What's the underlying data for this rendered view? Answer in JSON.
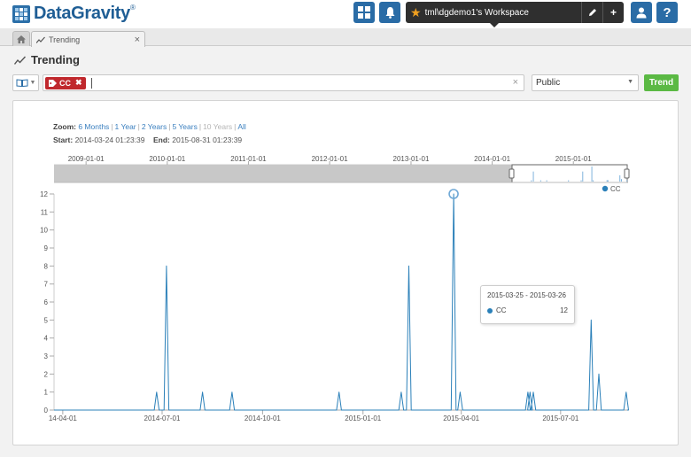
{
  "app": {
    "brand": "DataGravity",
    "brand_tm": "®",
    "workspace_label": "tml\\dgdemo1's Workspace"
  },
  "header": {
    "icons": [
      "dashboard-grid-icon",
      "bell-icon",
      "star-icon",
      "pencil-icon",
      "plus-icon",
      "user-icon",
      "help-icon"
    ],
    "help_label": "?",
    "plus_label": "+"
  },
  "tabs": [
    {
      "label": "Trending",
      "close": "×"
    }
  ],
  "page": {
    "title": "Trending"
  },
  "search": {
    "chip_label": "CC",
    "chip_close": "✖",
    "clear_label": "×",
    "scope_value": "Public",
    "trend_button": "Trend"
  },
  "zoom": {
    "label": "Zoom:",
    "options": [
      "6 Months",
      "1 Year",
      "2 Years",
      "5 Years",
      "10 Years",
      "All"
    ],
    "disabled_option": "10 Years",
    "start_label": "Start:",
    "start_value": "2014-03-24 01:23:39",
    "end_label": "End:",
    "end_value": "2015-08-31 01:23:39"
  },
  "navigator": {
    "ticks": [
      "2009-01-01",
      "2010-01-01",
      "2011-01-01",
      "2012-01-01",
      "2013-01-01",
      "2014-01-01",
      "2015-01-01"
    ]
  },
  "tooltip": {
    "range": "2015-03-25 - 2015-03-26",
    "series": "CC",
    "value": "12"
  },
  "colors": {
    "series": "#2b80b9",
    "brand": "#1f5e95",
    "chip": "#c0282d",
    "trend_button": "#5bb944"
  },
  "chart_data": {
    "type": "line",
    "series": [
      {
        "name": "CC",
        "points": [
          [
            "2014-06-26",
            1
          ],
          [
            "2014-07-05",
            8
          ],
          [
            "2014-08-07",
            1
          ],
          [
            "2014-09-03",
            1
          ],
          [
            "2014-12-10",
            1
          ],
          [
            "2015-02-05",
            1
          ],
          [
            "2015-02-12",
            8
          ],
          [
            "2015-03-25",
            12
          ],
          [
            "2015-03-31",
            1
          ],
          [
            "2015-06-01",
            1
          ],
          [
            "2015-06-03",
            1
          ],
          [
            "2015-06-06",
            1
          ],
          [
            "2015-07-29",
            5
          ],
          [
            "2015-08-05",
            2
          ],
          [
            "2015-08-30",
            1
          ]
        ]
      }
    ],
    "x_ticks": [
      "14-04-01",
      "2014-07-01",
      "2014-10-01",
      "2015-01-01",
      "2015-04-01",
      "2015-07-01"
    ],
    "y_ticks": [
      "0",
      "1",
      "2",
      "3",
      "4",
      "5",
      "6",
      "7",
      "8",
      "9",
      "10",
      "11",
      "12"
    ],
    "ylim": [
      0,
      12
    ],
    "legend": "top-right",
    "grid": false
  }
}
